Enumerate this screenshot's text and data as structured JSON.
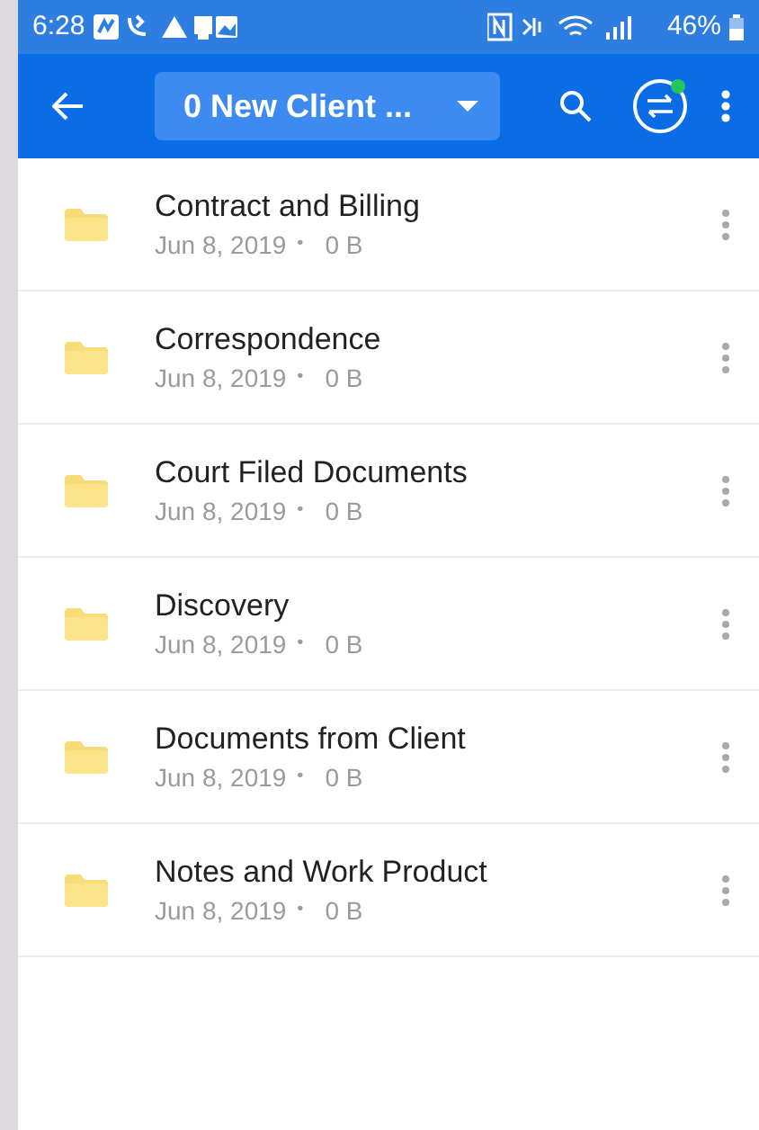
{
  "status_bar": {
    "time": "6:28",
    "battery": "46%"
  },
  "app_bar": {
    "title": "0 New Client ...",
    "sync_badge": true
  },
  "folders": [
    {
      "name": "Contract and Billing",
      "date": "Jun 8, 2019",
      "separator": "•",
      "size": "0 B"
    },
    {
      "name": "Correspondence",
      "date": "Jun 8, 2019",
      "separator": "•",
      "size": "0 B"
    },
    {
      "name": "Court Filed Documents",
      "date": "Jun 8, 2019",
      "separator": "•",
      "size": "0 B"
    },
    {
      "name": "Discovery",
      "date": "Jun 8, 2019",
      "separator": "•",
      "size": "0 B"
    },
    {
      "name": "Documents from Client",
      "date": "Jun 8, 2019",
      "separator": "•",
      "size": "0 B"
    },
    {
      "name": "Notes and Work Product",
      "date": "Jun 8, 2019",
      "separator": "•",
      "size": "0 B"
    }
  ]
}
